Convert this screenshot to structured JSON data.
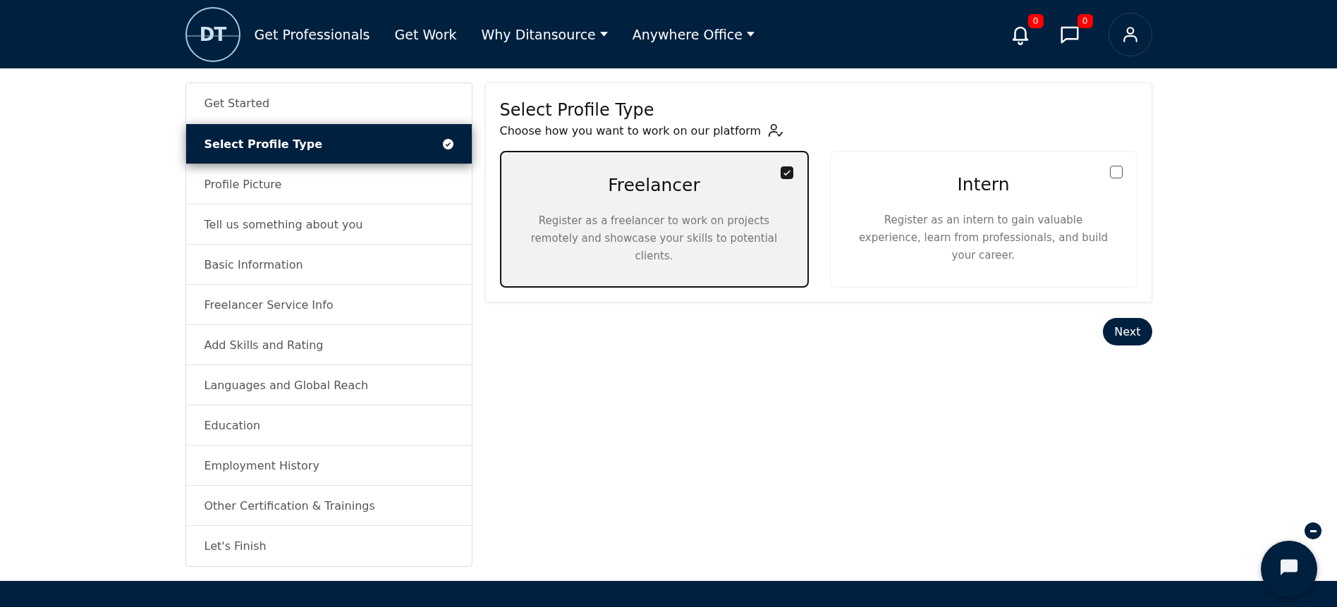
{
  "header": {
    "logo": "DT",
    "nav": [
      {
        "label": "Get Professionals",
        "dropdown": false
      },
      {
        "label": "Get Work",
        "dropdown": false
      },
      {
        "label": "Why Ditansource",
        "dropdown": true
      },
      {
        "label": "Anywhere Office",
        "dropdown": true
      }
    ],
    "notifications_count": "0",
    "messages_count": "0"
  },
  "sidebar": {
    "items": [
      {
        "label": "Get Started",
        "selected": false
      },
      {
        "label": "Select Profile Type",
        "selected": true
      },
      {
        "label": "Profile Picture",
        "selected": false
      },
      {
        "label": "Tell us something about you",
        "selected": false
      },
      {
        "label": "Basic Information",
        "selected": false
      },
      {
        "label": "Freelancer Service Info",
        "selected": false
      },
      {
        "label": "Add Skills and Rating",
        "selected": false
      },
      {
        "label": "Languages and Global Reach",
        "selected": false
      },
      {
        "label": "Education",
        "selected": false
      },
      {
        "label": "Employment History",
        "selected": false
      },
      {
        "label": "Other Certification & Trainings",
        "selected": false
      },
      {
        "label": "Let's Finish",
        "selected": false
      }
    ]
  },
  "panel": {
    "title": "Select Profile Type",
    "subtitle": "Choose how you want to work on our platform",
    "options": [
      {
        "title": "Freelancer",
        "description": "Register as a freelancer to work on projects remotely and showcase your skills to potential clients.",
        "selected": true
      },
      {
        "title": "Intern",
        "description": "Register as an intern to gain valuable experience, learn from professionals, and build your career.",
        "selected": false
      }
    ]
  },
  "next_button": "Next"
}
